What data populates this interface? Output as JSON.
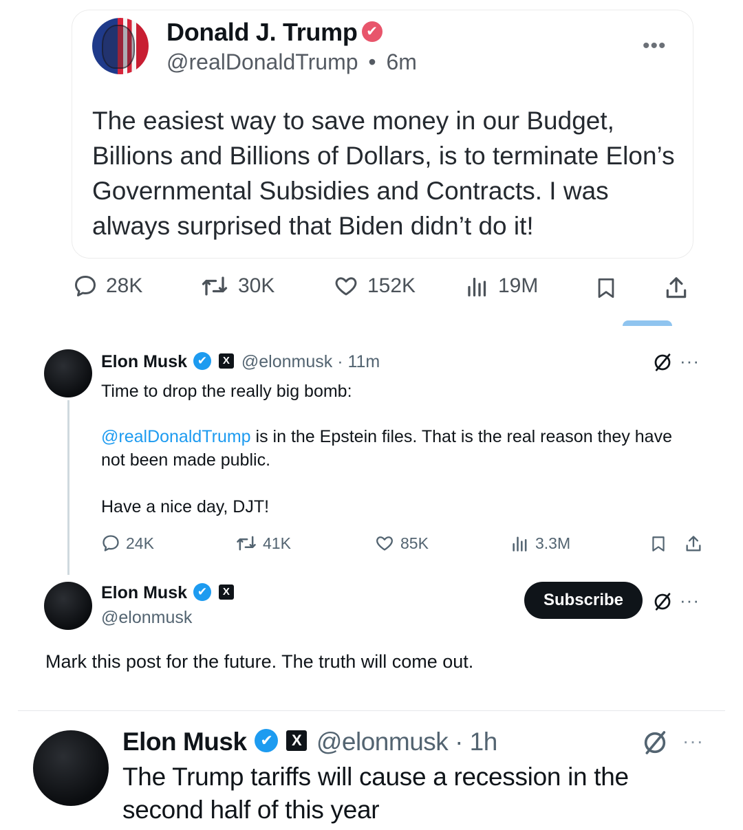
{
  "truth_post": {
    "author_name": "Donald J. Trump",
    "verified_mark": "✔",
    "handle": "@realDonaldTrump",
    "separator": "•",
    "time": "6m",
    "more_label": "•••",
    "text": "The easiest way to save money in our Budget, Billions and Billions of Dollars, is to terminate Elon’s Governmental Subsidies and Contracts. I was always surprised that Biden didn’t do it!",
    "stats": {
      "replies": "28K",
      "retruths": "30K",
      "likes": "152K",
      "views": "19M"
    }
  },
  "x_post_1": {
    "author_name": "Elon Musk",
    "x_badge": "X",
    "handle": "@elonmusk",
    "time": "· 11m",
    "more_label": "···",
    "line1": "Time to drop the really big bomb:",
    "mention": "@realDonaldTrump",
    "line2_rest": " is in the Epstein files. That is the real reason they have not been made public.",
    "line3": "Have a nice day, DJT!",
    "stats": {
      "replies": "24K",
      "reposts": "41K",
      "likes": "85K",
      "views": "3.3M"
    }
  },
  "x_post_2": {
    "author_name": "Elon Musk",
    "x_badge": "X",
    "handle": "@elonmusk",
    "subscribe_label": "Subscribe",
    "more_label": "···",
    "text": "Mark this post for the future. The truth will come out."
  },
  "x_post_3": {
    "author_name": "Elon Musk",
    "x_badge": "X",
    "handle": "@elonmusk",
    "time": "· 1h",
    "more_label": "···",
    "text": "The Trump tariffs will cause a recession in the second half of this year"
  },
  "icons": [
    "reply-icon",
    "repost-icon",
    "like-icon",
    "views-icon",
    "bookmark-icon",
    "share-icon",
    "grok-icon",
    "verified-icon"
  ],
  "colors": {
    "truth_verified": "#e8556b",
    "x_verified": "#1d9bf0",
    "link": "#1d9bf0",
    "subscribe_bg": "#0f1419"
  }
}
